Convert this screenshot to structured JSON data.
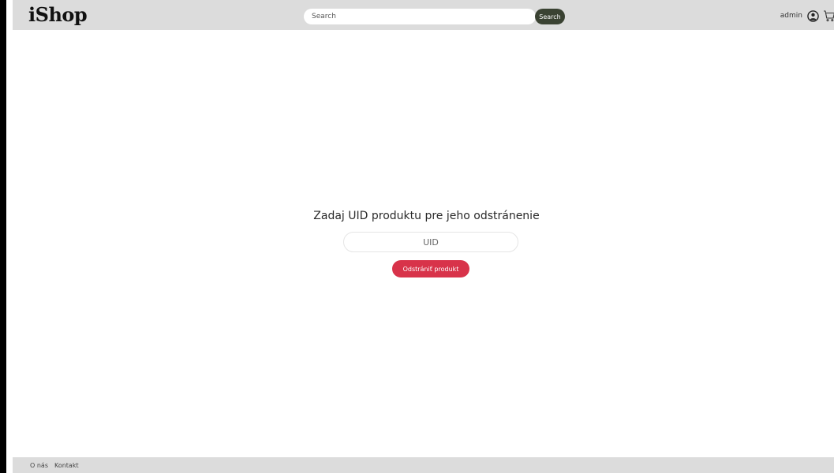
{
  "header": {
    "logo": "iShop",
    "search": {
      "placeholder": "Search",
      "value": "",
      "button_label": "Search"
    },
    "user": {
      "name": "admin",
      "account_icon": "user-circle-icon",
      "cart_icon": "cart-icon"
    }
  },
  "main": {
    "title": "Zadaj UID produktu pre jeho odstránenie",
    "uid_input": {
      "placeholder": "UID",
      "value": ""
    },
    "remove_button_label": "Odstrániť produkt"
  },
  "footer": {
    "links": [
      "O nás",
      "Kontakt"
    ]
  },
  "colors": {
    "header_bg": "#dcdcdc",
    "search_button": "#3a4232",
    "remove_button": "#d8334a"
  }
}
